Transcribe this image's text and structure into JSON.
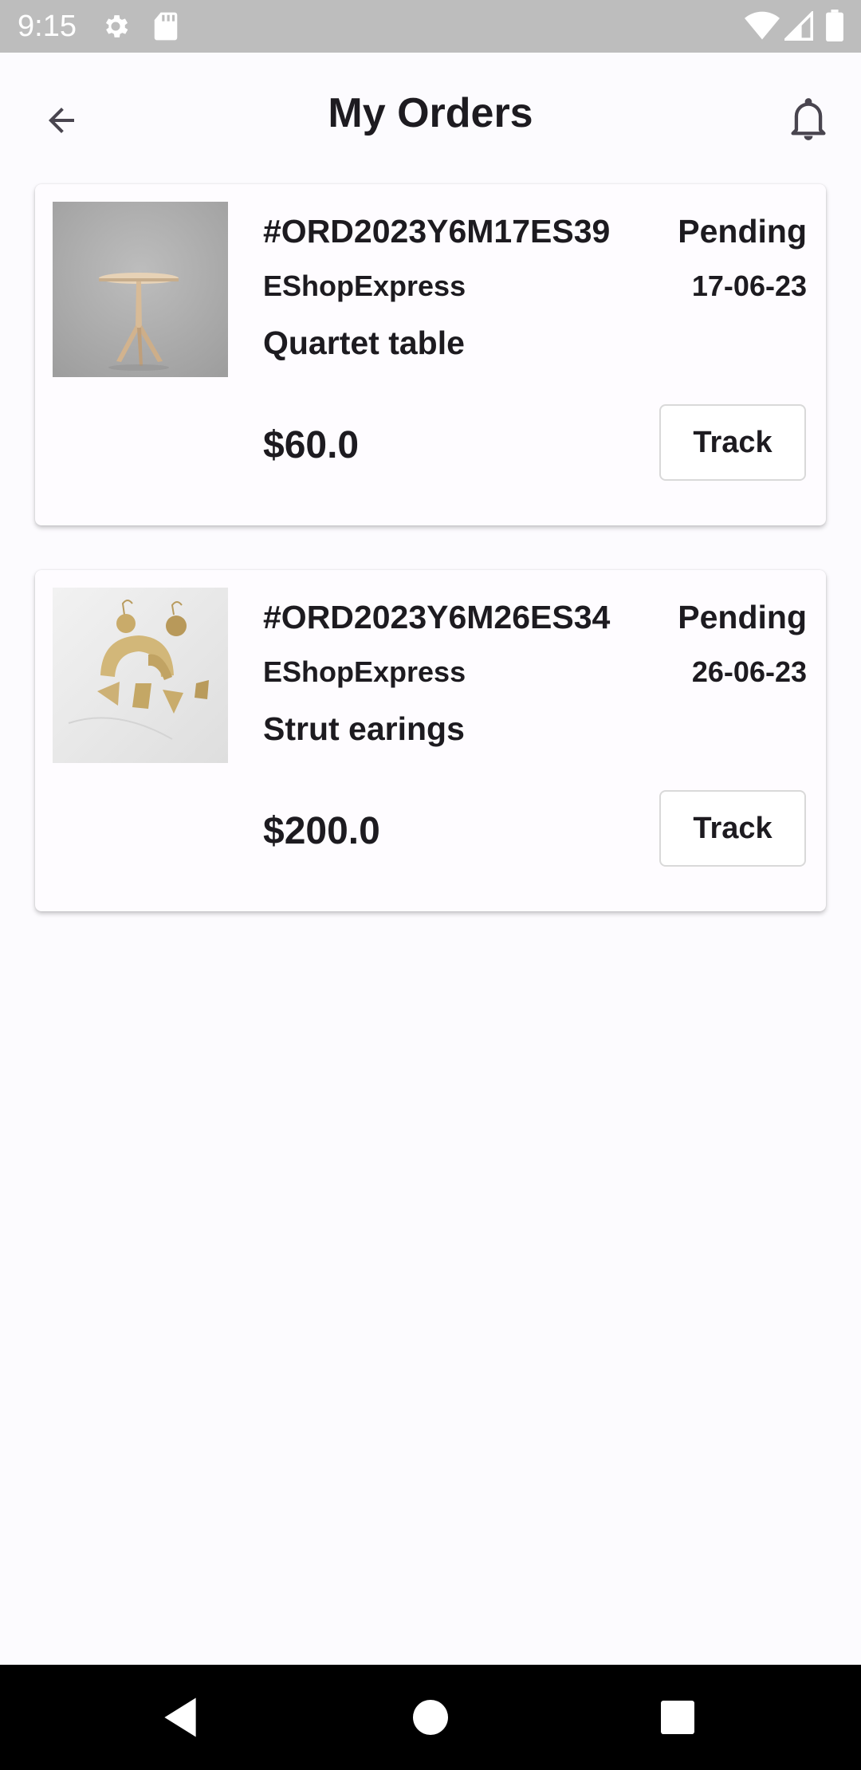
{
  "status_bar": {
    "time": "9:15",
    "icons": [
      "gear-icon",
      "sd-card-icon",
      "wifi-icon",
      "cellular-signal-icon",
      "battery-icon"
    ]
  },
  "app_bar": {
    "title": "My Orders",
    "back_icon": "arrow-left-icon",
    "notification_icon": "bell-icon"
  },
  "orders": [
    {
      "order_id": "#ORD2023Y6M17ES39",
      "status": "Pending",
      "store": "EShopExpress",
      "date": "17-06-23",
      "product": "Quartet table",
      "price": "$60.0",
      "action_label": "Track",
      "image": "table-photo"
    },
    {
      "order_id": "#ORD2023Y6M26ES34",
      "status": "Pending",
      "store": "EShopExpress",
      "date": "26-06-23",
      "product": "Strut earings",
      "price": "$200.0",
      "action_label": "Track",
      "image": "earrings-photo"
    }
  ],
  "nav_bar": {
    "icons": [
      "back-triangle-icon",
      "home-circle-icon",
      "recents-square-icon"
    ]
  },
  "colors": {
    "background": "#fcfbfe",
    "status_bar": "#bdbdbd",
    "text": "#1d1b20",
    "card_border": "#d9d9d9"
  }
}
